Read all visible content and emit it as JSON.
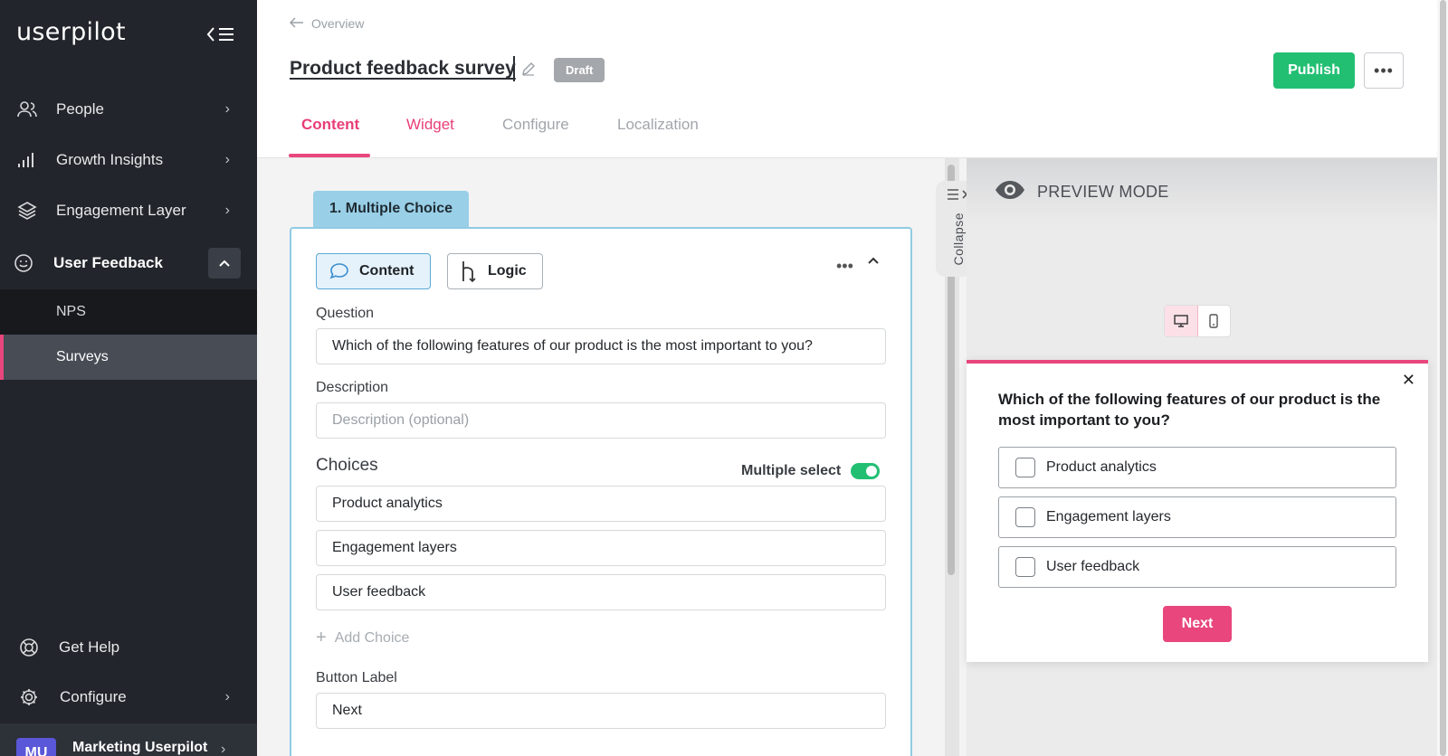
{
  "sidebar": {
    "logo": "userpilot",
    "items": [
      {
        "label": "People",
        "icon": "people-icon"
      },
      {
        "label": "Growth Insights",
        "icon": "bar-chart-icon"
      },
      {
        "label": "Engagement Layer",
        "icon": "layers-icon"
      },
      {
        "label": "User Feedback",
        "icon": "smile-icon"
      }
    ],
    "sub_items": [
      {
        "label": "NPS"
      },
      {
        "label": "Surveys"
      }
    ],
    "bottom_items": [
      {
        "label": "Get Help",
        "icon": "help-icon"
      },
      {
        "label": "Configure",
        "icon": "gear-icon"
      }
    ],
    "account": {
      "initials": "MU",
      "name": "Marketing Userpilot"
    }
  },
  "header": {
    "breadcrumb": "Overview",
    "title": "Product feedback survey",
    "status": "Draft",
    "publish_label": "Publish",
    "tabs": [
      {
        "label": "Content"
      },
      {
        "label": "Widget"
      },
      {
        "label": "Configure"
      },
      {
        "label": "Localization"
      }
    ]
  },
  "editor": {
    "step_tab": "1. Multiple Choice",
    "segments": {
      "content": "Content",
      "logic": "Logic"
    },
    "question_label": "Question",
    "question_value": "Which of the following features of our product is the most important to you?",
    "description_label": "Description",
    "description_placeholder": "Description (optional)",
    "choices_label": "Choices",
    "multiple_select_label": "Multiple select",
    "multiple_select_on": true,
    "choices": [
      "Product analytics",
      "Engagement layers",
      "User feedback"
    ],
    "add_choice_label": "Add Choice",
    "button_label_label": "Button Label",
    "button_label_value": "Next"
  },
  "collapse_label": "Collapse",
  "preview": {
    "mode_label": "PREVIEW MODE",
    "question": "Which of the following features of our product is the most important to you?",
    "options": [
      "Product analytics",
      "Engagement layers",
      "User feedback"
    ],
    "next_label": "Next"
  },
  "colors": {
    "accent": "#e8467c",
    "publish": "#22bf73",
    "sidebar": "#22252b",
    "step_tab": "#99cfe7"
  }
}
